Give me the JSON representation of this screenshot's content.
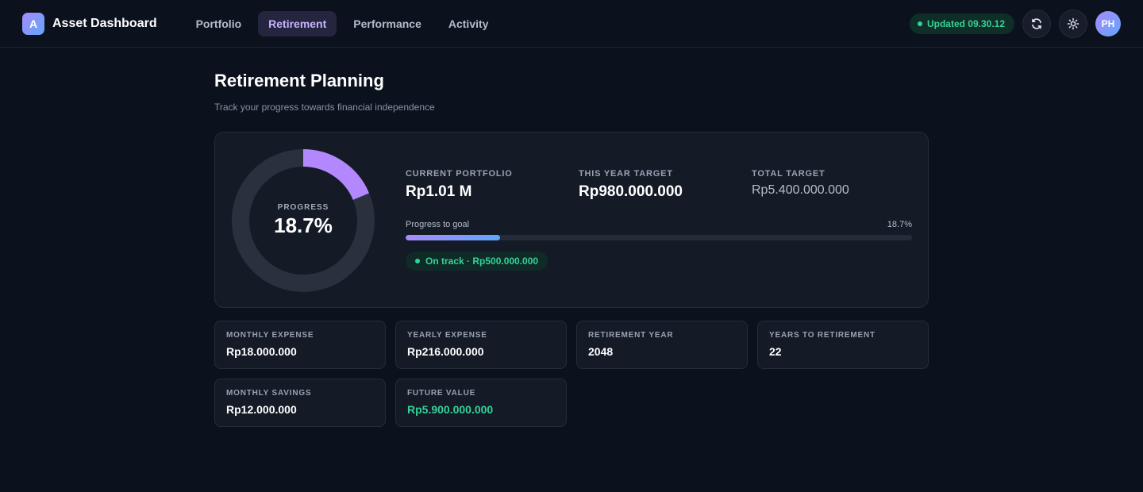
{
  "app": {
    "logo_letter": "A",
    "title": "Asset Dashboard"
  },
  "nav": {
    "tabs": [
      {
        "label": "Portfolio",
        "active": false
      },
      {
        "label": "Retirement",
        "active": true
      },
      {
        "label": "Performance",
        "active": false
      },
      {
        "label": "Activity",
        "active": false
      }
    ]
  },
  "header": {
    "updated_label": "Updated 09.30.12",
    "refresh_icon": "refresh-icon",
    "theme_icon": "sun-icon",
    "avatar_initials": "PH"
  },
  "page": {
    "title": "Retirement Planning",
    "subtitle": "Track your progress towards financial independence"
  },
  "summary": {
    "progress_label": "PROGRESS",
    "progress_value": "18.7%",
    "progress_fraction": 0.187,
    "current_portfolio_label": "CURRENT PORTFOLIO",
    "current_portfolio_value": "Rp1.01 M",
    "this_year_target_label": "THIS YEAR TARGET",
    "this_year_target_value": "Rp980.000.000",
    "total_target_label": "TOTAL TARGET",
    "total_target_value": "Rp5.400.000.000",
    "progress_to_goal_label": "Progress to goal",
    "progress_to_goal_value": "18.7%",
    "status_badge": "On track · Rp500.000.000"
  },
  "cards": [
    {
      "label": "MONTHLY EXPENSE",
      "value": "Rp18.000.000"
    },
    {
      "label": "YEARLY EXPENSE",
      "value": "Rp216.000.000"
    },
    {
      "label": "RETIREMENT YEAR",
      "value": "2048"
    },
    {
      "label": "YEARS TO RETIREMENT",
      "value": "22"
    },
    {
      "label": "MONTHLY SAVINGS",
      "value": "Rp12.000.000"
    },
    {
      "label": "FUTURE VALUE",
      "value": "Rp5.900.000.000"
    }
  ],
  "colors": {
    "accent_purple": "#a78bfa",
    "accent_blue": "#60a5fa",
    "success_green": "#34d399",
    "background": "#0b111d",
    "card": "#141a26"
  }
}
